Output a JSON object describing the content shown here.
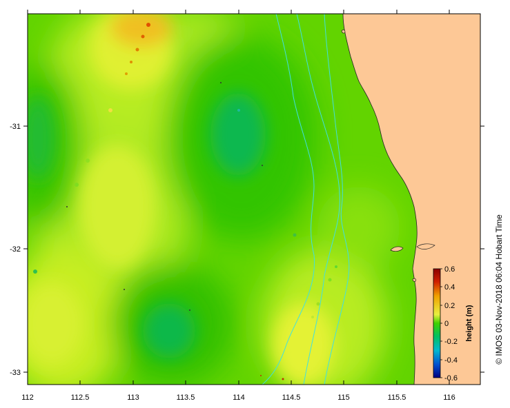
{
  "credit": "© IMOS 03-Nov-2018 06:04 Hobart Time",
  "colorbar": {
    "title": "height (m)",
    "ticks": [
      "0.6",
      "0.4",
      "0.2",
      "0",
      "-0.2",
      "-0.4",
      "-0.6"
    ],
    "colors": [
      "#8b0000",
      "#d03000",
      "#f0a000",
      "#e8f040",
      "#00c800",
      "#00b8a0",
      "#0070e0",
      "#000080"
    ]
  },
  "axes": {
    "x_ticks": [
      "112",
      "112.5",
      "113",
      "113.5",
      "114",
      "114.5",
      "115",
      "115.5",
      "116"
    ],
    "y_ticks": [
      "-31",
      "-32",
      "-33"
    ]
  },
  "colors": {
    "land": "#fdc896",
    "ocean_base": "#62d400",
    "isobath": "#40e0e0"
  }
}
